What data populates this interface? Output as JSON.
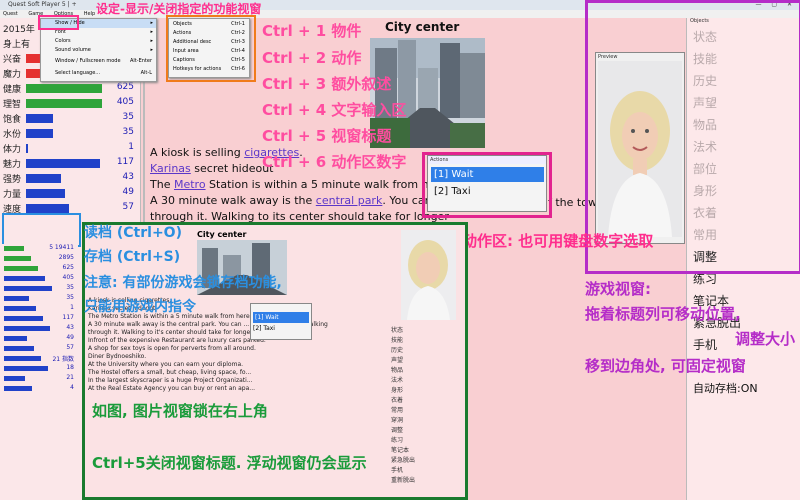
{
  "window": {
    "title": "Quest Soft Player 5 | +",
    "controls": "— ▢ ✕"
  },
  "menubar": [
    "Quest",
    "Game",
    "Options",
    "Help"
  ],
  "view_menu": [
    {
      "label": "Show / Hide",
      "key": "",
      "submenu": true
    },
    {
      "label": "Font",
      "key": "",
      "submenu": true
    },
    {
      "label": "Colors",
      "key": "",
      "submenu": true
    },
    {
      "label": "Sound volume",
      "key": "",
      "submenu": true
    },
    {
      "label": "Window / Fullscreen mode",
      "key": "Alt-Enter",
      "submenu": false
    },
    {
      "label": "Select language...",
      "key": "Alt-L",
      "submenu": false
    }
  ],
  "showhide_menu": [
    {
      "label": "Objects",
      "key": "Ctrl-1"
    },
    {
      "label": "Actions",
      "key": "Ctrl-2"
    },
    {
      "label": "Additional desc",
      "key": "Ctrl-3"
    },
    {
      "label": "Input area",
      "key": "Ctrl-4"
    },
    {
      "label": "Captions",
      "key": "Ctrl-5"
    },
    {
      "label": "Hotkeys for actions",
      "key": "Ctrl-6"
    }
  ],
  "stats": [
    {
      "label": "2015年",
      "value": "",
      "bar": "",
      "fill": 0
    },
    {
      "label": "身上有",
      "value": "",
      "bar": "",
      "fill": 0
    },
    {
      "label": "兴奋",
      "value": "",
      "bar": "#e53030",
      "fill": 0.4
    },
    {
      "label": "魔力",
      "value": "",
      "bar": "#e53030",
      "fill": 0.3
    },
    {
      "label": "健康",
      "value": "625",
      "bar": "#2fa43a",
      "fill": 0.98
    },
    {
      "label": "理智",
      "value": "405",
      "bar": "#2fa43a",
      "fill": 0.98
    },
    {
      "label": "饱食",
      "value": "35",
      "bar": "#2142c9",
      "fill": 0.35
    },
    {
      "label": "水份",
      "value": "35",
      "bar": "#2142c9",
      "fill": 0.35
    },
    {
      "label": "体力",
      "value": "1",
      "bar": "#2142c9",
      "fill": 0.02
    },
    {
      "label": "魅力",
      "value": "117",
      "bar": "#2142c9",
      "fill": 0.95
    },
    {
      "label": "强势",
      "value": "43",
      "bar": "#2142c9",
      "fill": 0.45
    },
    {
      "label": "力量",
      "value": "49",
      "bar": "#2142c9",
      "fill": 0.5
    },
    {
      "label": "速度",
      "value": "57",
      "bar": "#2142c9",
      "fill": 0.55
    }
  ],
  "location": {
    "title": "City center",
    "lines": [
      {
        "pre": "A kiosk is selling ",
        "link": "cigarettes",
        "post": "."
      },
      {
        "pre": "",
        "link": "Karinas",
        "post": " secret hideout"
      },
      {
        "pre": "The ",
        "link": "Metro",
        "post": " Station is within a 5 minute walk from he"
      },
      {
        "pre": "A 30 minute walk away is the ",
        "link": "central park",
        "post": ". You can"
      },
      {
        "pre": "through it. Walking to its center should take for longer",
        "link": "",
        "post": ""
      }
    ],
    "tail": "f the town"
  },
  "actions": {
    "header": "Actions",
    "items": [
      "[1] Wait",
      "[2] Taxi"
    ]
  },
  "preview": {
    "header": "Preview"
  },
  "objects_panel": {
    "header": "Objects",
    "items": [
      "状态",
      "技能",
      "历史",
      "声望",
      "物品",
      "法术",
      "部位",
      "身形",
      "衣着",
      "常用",
      "调整",
      "练习",
      "笔记本",
      "紧急脱出",
      "手机"
    ],
    "autosave": "自动存档:ON"
  },
  "annotations": {
    "top": "设定-显示/关闭指定的功能视窗",
    "ctrl1": "Ctrl + 1 物件",
    "ctrl2": "Ctrl + 2 动作",
    "ctrl3": "Ctrl + 3 额外叙述",
    "ctrl4": "Ctrl + 4 文字输入区",
    "ctrl5": "Ctrl + 5 视窗标题",
    "ctrl6": "Ctrl + 6 动作区数字",
    "load": "读档 (Ctrl+O)",
    "save": "存档 (Ctrl+S)",
    "note1": "注意: 有部份游戏会锁存档功能,",
    "note2": "只能用游戏内指令",
    "action_area": "动作区: 也可用键盘数字选取",
    "game_view1": "游戏视窗:",
    "game_view2": "拖着标题列可移动位置,",
    "game_view3": "调整大小",
    "game_view4": "移到边角处, 可固定视窗",
    "inset_note1": "如图, 图片视窗锁在右上角",
    "inset_note2": "Ctrl+5关闭视窗标题. 浮动视窗仍会显示"
  },
  "inset": {
    "city_title": "City center",
    "actions": [
      "[1] Wait",
      "[2] Taxi"
    ],
    "lines": [
      "A kiosk is selling cigarettes.",
      "Karinas secret hideout",
      "The Metro Station is within a 5 minute walk from here.",
      "A 30 minute walk away is the central park. You can ... of the town while walking",
      "through it. Walking to it's center should take for longer.",
      "Infront of the expensive Restaurant are luxury cars parked.",
      "A shop for sex toys is open for perverts from all around.",
      "Diner Bydnoeshiko.",
      "At the University where you can earn your diploma.",
      "The Hostel offers a small, but cheap, living space, fo...",
      "In the largest skyscraper is a huge Project Organizati...",
      "At the Real Estate Agency you can buy or rent an apa..."
    ],
    "objects": [
      "状态",
      "技能",
      "历史",
      "声望",
      "物品",
      "法术",
      "身形",
      "衣着",
      "常用",
      "穿洞",
      "调整",
      "练习",
      "笔记本",
      "紧急脱出",
      "手机",
      "重新脱出"
    ],
    "left_vals": [
      "5 19411",
      "2895",
      "625",
      "405",
      "35",
      "35",
      "1",
      "117",
      "43",
      "49",
      "57",
      "21 指数",
      "18",
      "21",
      "4"
    ]
  }
}
